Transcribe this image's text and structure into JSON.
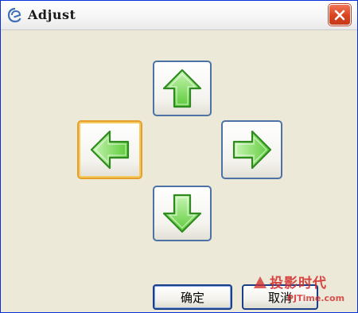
{
  "window": {
    "title": "Adjust",
    "icon": "app-logo-icon",
    "close_icon": "close-icon"
  },
  "arrows": {
    "up_icon": "arrow-up-icon",
    "left_icon": "arrow-left-icon",
    "right_icon": "arrow-right-icon",
    "down_icon": "arrow-down-icon",
    "focused": "left"
  },
  "buttons": {
    "ok_label": "确定",
    "cancel_label": "取消"
  },
  "watermark": {
    "brand_cn": "投影时代",
    "brand_url": "PJTime.com"
  },
  "colors": {
    "arrow_fill": "#7bdc5a",
    "arrow_stroke": "#2f8a1f",
    "title_close": "#d9441e",
    "focus_border": "#e3a12a"
  }
}
